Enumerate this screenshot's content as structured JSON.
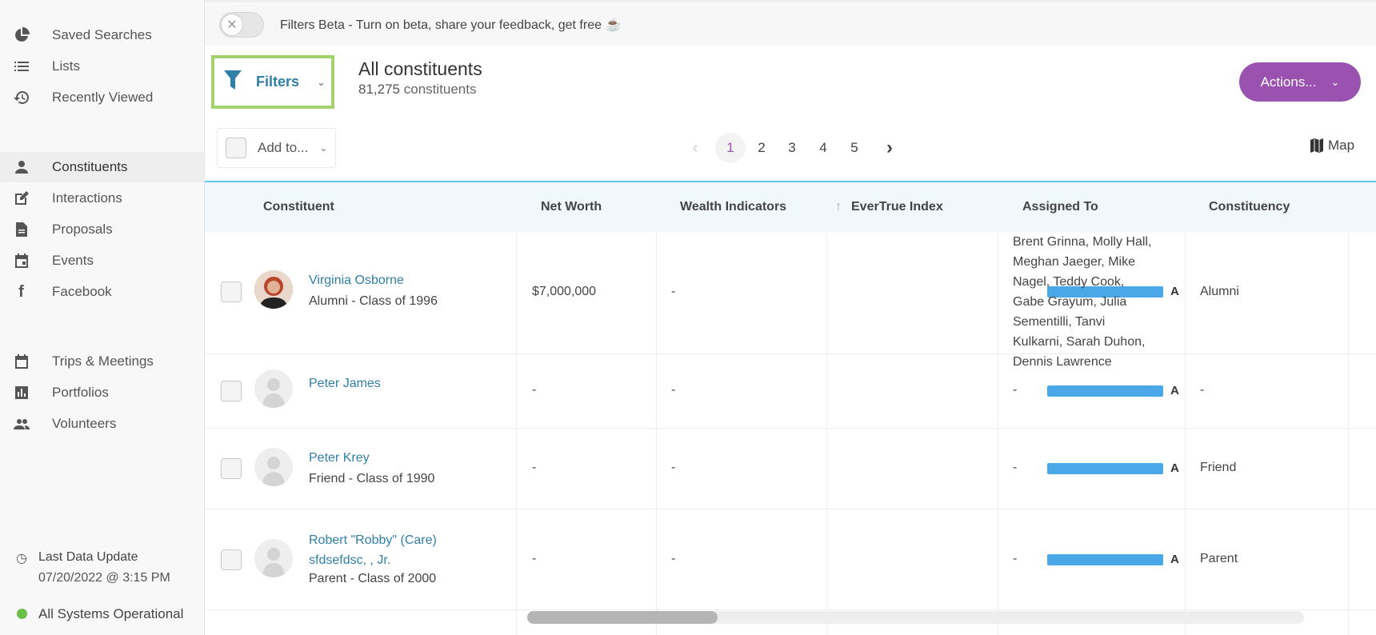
{
  "sidebar": {
    "items": [
      {
        "label": "Saved Searches",
        "icon": "pie-chart-icon"
      },
      {
        "label": "Lists",
        "icon": "list-icon"
      },
      {
        "label": "Recently Viewed",
        "icon": "history-icon"
      },
      {
        "label": "Constituents",
        "icon": "person-icon",
        "active": true
      },
      {
        "label": "Interactions",
        "icon": "edit-icon"
      },
      {
        "label": "Proposals",
        "icon": "document-icon"
      },
      {
        "label": "Events",
        "icon": "calendar-icon"
      },
      {
        "label": "Facebook",
        "icon": "facebook-icon"
      },
      {
        "label": "Trips & Meetings",
        "icon": "calendar-trip-icon"
      },
      {
        "label": "Portfolios",
        "icon": "bar-chart-icon"
      },
      {
        "label": "Volunteers",
        "icon": "people-icon"
      }
    ],
    "last_update_label": "Last Data Update",
    "last_update_value": "07/20/2022 @ 3:15 PM",
    "status": "All Systems Operational",
    "status_color": "#6cc04a"
  },
  "banner": {
    "text": "Filters Beta - Turn on beta, share your feedback, get free ☕",
    "toggle_on": false
  },
  "header": {
    "filters_label": "Filters",
    "title": "All constituents",
    "count": "81,275",
    "count_suffix": "constituents",
    "actions_label": "Actions..."
  },
  "toolbar": {
    "add_to_label": "Add to...",
    "pages": [
      "1",
      "2",
      "3",
      "4",
      "5"
    ],
    "current_page": "1",
    "map_label": "Map"
  },
  "table": {
    "columns": [
      "Constituent",
      "Net Worth",
      "Wealth Indicators",
      "EverTrue Index",
      "Assigned To",
      "Constituency"
    ],
    "rows": [
      {
        "name": "Virginia Osborne",
        "subtitle": "Alumni - Class of 1996",
        "net_worth": "$7,000,000",
        "wealth": "-",
        "grade": "A",
        "assigned": "Brent Grinna, Molly Hall, Meghan Jaeger, Mike Nagel, Teddy Cook, Gabe Grayum, Julia Sementilli, Tanvi Kulkarni, Sarah Duhon, Dennis Lawrence",
        "constituency": "Alumni"
      },
      {
        "name": "Peter James",
        "subtitle": "",
        "net_worth": "-",
        "wealth": "-",
        "grade": "A",
        "assigned": "-",
        "constituency": "-"
      },
      {
        "name": "Peter Krey",
        "subtitle": "Friend - Class of 1990",
        "net_worth": "-",
        "wealth": "-",
        "grade": "A",
        "assigned": "-",
        "constituency": "Friend"
      },
      {
        "name": "Robert \"Robby\" (Care) sfdsefdsc, , Jr.",
        "subtitle": "Parent - Class of 2000",
        "net_worth": "-",
        "wealth": "-",
        "grade": "A",
        "assigned": "-",
        "constituency": "Parent"
      }
    ]
  },
  "colors": {
    "accent": "#9b51b0",
    "link": "#2f7fa7",
    "highlight": "#a3d16e",
    "bar": "#4aa8e8"
  }
}
